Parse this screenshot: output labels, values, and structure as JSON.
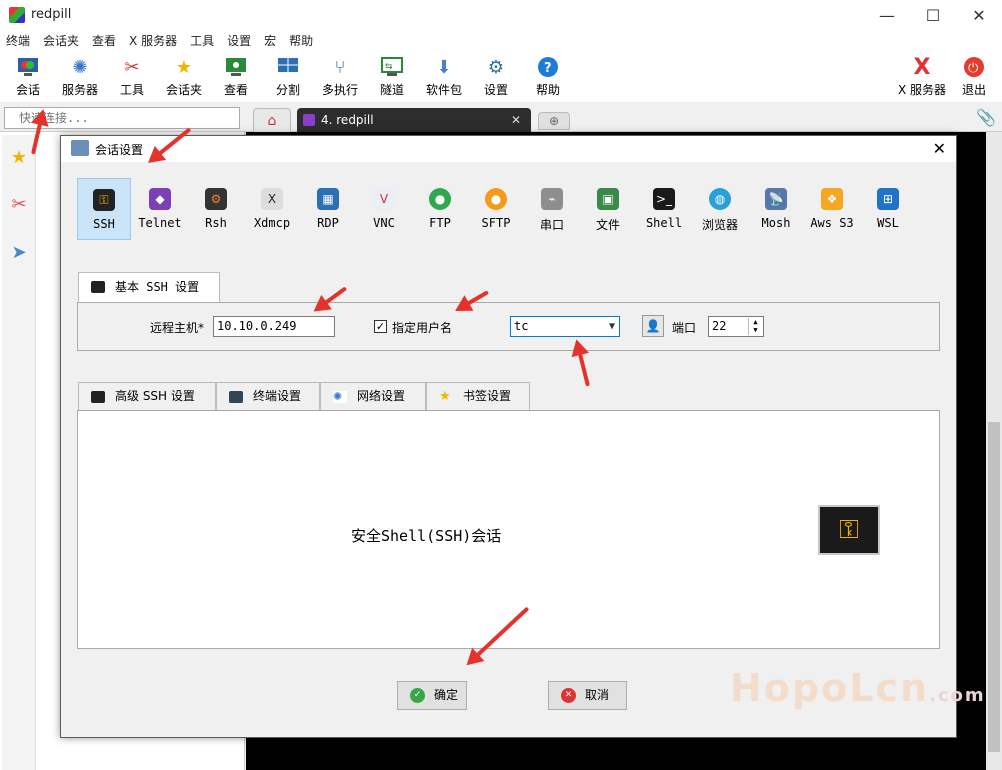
{
  "window": {
    "title": "redpill"
  },
  "menu": [
    "终端",
    "会话夹",
    "查看",
    "X 服务器",
    "工具",
    "设置",
    "宏",
    "帮助"
  ],
  "toolbar": {
    "left": [
      {
        "label": "会话",
        "icon": "session-icon"
      },
      {
        "label": "服务器",
        "icon": "servers-icon"
      },
      {
        "label": "工具",
        "icon": "tools-icon"
      },
      {
        "label": "会话夹",
        "icon": "star-icon"
      },
      {
        "label": "查看",
        "icon": "view-icon"
      },
      {
        "label": "分割",
        "icon": "split-icon"
      },
      {
        "label": "多执行",
        "icon": "multiexec-icon"
      },
      {
        "label": "隧道",
        "icon": "tunnel-icon"
      },
      {
        "label": "软件包",
        "icon": "package-icon"
      },
      {
        "label": "设置",
        "icon": "gear-icon"
      },
      {
        "label": "帮助",
        "icon": "help-icon"
      }
    ],
    "right": [
      {
        "label": "X 服务器",
        "icon": "x-server-icon"
      },
      {
        "label": "退出",
        "icon": "power-icon"
      }
    ]
  },
  "quick_connect": {
    "placeholder": "快速连接..."
  },
  "tabs": {
    "active_label": "4. redpill"
  },
  "dialog": {
    "title": "会话设置",
    "session_types": [
      "SSH",
      "Telnet",
      "Rsh",
      "Xdmcp",
      "RDP",
      "VNC",
      "FTP",
      "SFTP",
      "串口",
      "文件",
      "Shell",
      "浏览器",
      "Mosh",
      "Aws S3",
      "WSL"
    ],
    "selected_type": "SSH",
    "basic_tab": "基本 SSH 设置",
    "remote_host_label": "远程主机*",
    "remote_host_value": "10.10.0.249",
    "specify_user_label": "指定用户名",
    "specify_user_checked": true,
    "username_value": "tc",
    "port_label": "端口",
    "port_value": "22",
    "sub_tabs": [
      "高级 SSH 设置",
      "终端设置",
      "网络设置",
      "书签设置"
    ],
    "panel_text": "安全Shell(SSH)会话",
    "ok_label": "确定",
    "cancel_label": "取消"
  },
  "watermark": {
    "main": "HopoLcn",
    "suffix": ".com"
  },
  "colors": {
    "accent": "#0078d7",
    "selected_bg": "#cce4f7",
    "arrow": "#e5322d",
    "terminal_bg": "#000000"
  }
}
